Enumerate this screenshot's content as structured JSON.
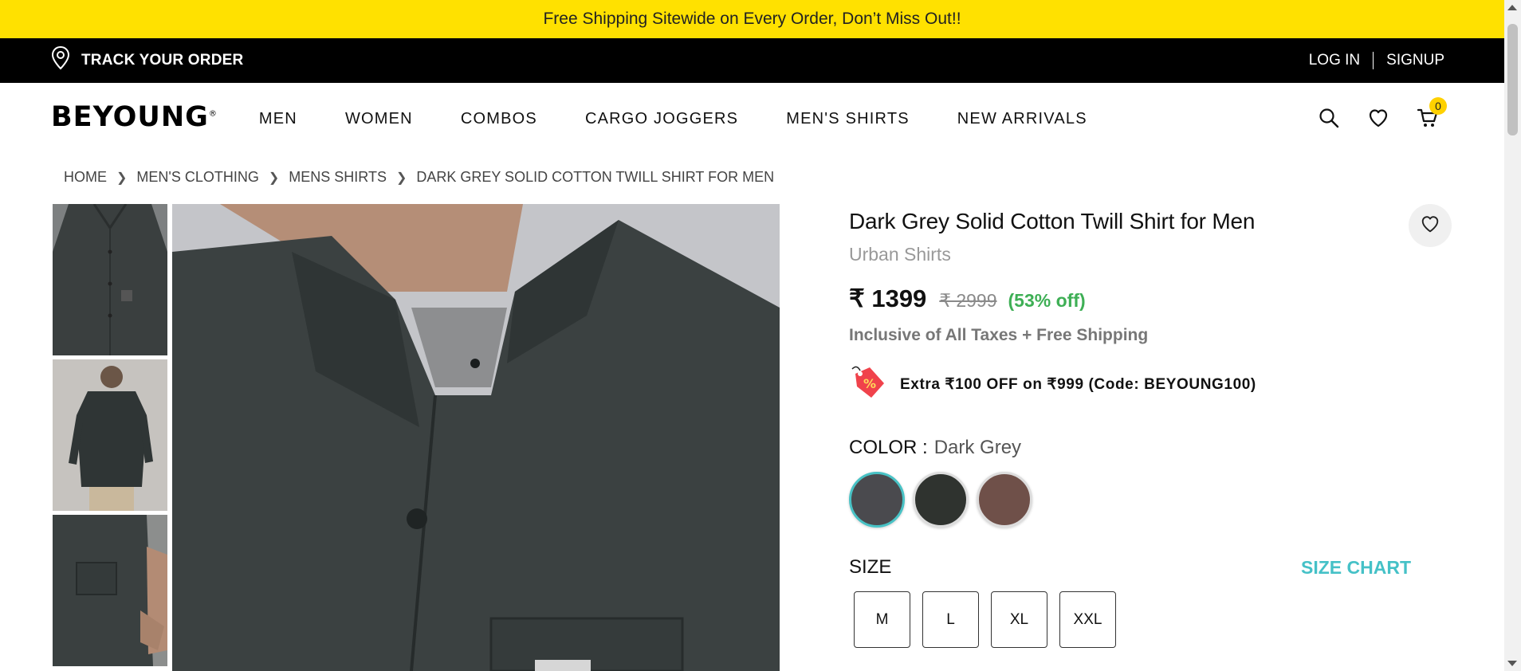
{
  "promo": {
    "text": "Free Shipping Sitewide on Every Order, Don’t Miss Out!!"
  },
  "topbar": {
    "track_label": "TRACK YOUR ORDER",
    "login": "LOG IN",
    "signup": "SIGNUP"
  },
  "nav": {
    "logo": "BEYOUNG",
    "logo_mark": "®",
    "items": [
      "MEN",
      "WOMEN",
      "COMBOS",
      "CARGO JOGGERS",
      "MEN'S SHIRTS",
      "NEW ARRIVALS"
    ],
    "cart_count": "0",
    "icons": [
      "search-icon",
      "heart-icon",
      "cart-icon"
    ]
  },
  "breadcrumb": [
    "HOME",
    "MEN'S CLOTHING",
    "MENS SHIRTS",
    "DARK GREY SOLID COTTON TWILL SHIRT FOR MEN"
  ],
  "product": {
    "title": "Dark Grey Solid Cotton Twill Shirt for Men",
    "subtitle": "Urban Shirts",
    "price": "₹ 1399",
    "mrp": "₹ 2999",
    "discount": "(53% off)",
    "tax_note": "Inclusive of All Taxes + Free Shipping",
    "offer": "Extra ₹100 OFF on ₹999 (Code: BEYOUNG100)",
    "color_label": "COLOR :",
    "color_value": "Dark Grey",
    "swatches": [
      {
        "name": "Dark Grey",
        "hex": "#4a4a4e",
        "selected": true
      },
      {
        "name": "Black Olive",
        "hex": "#2f332f",
        "selected": false
      },
      {
        "name": "Brown",
        "hex": "#6f5049",
        "selected": false
      }
    ],
    "size_label": "SIZE",
    "size_chart": "SIZE CHART",
    "sizes": [
      "M",
      "L",
      "XL",
      "XXL"
    ]
  },
  "colors": {
    "promo_bg": "#ffe100",
    "topbar_bg": "#000000",
    "accent_teal": "#45c1c7",
    "discount_green": "#3eaf55",
    "badge_yellow": "#ffd100"
  }
}
